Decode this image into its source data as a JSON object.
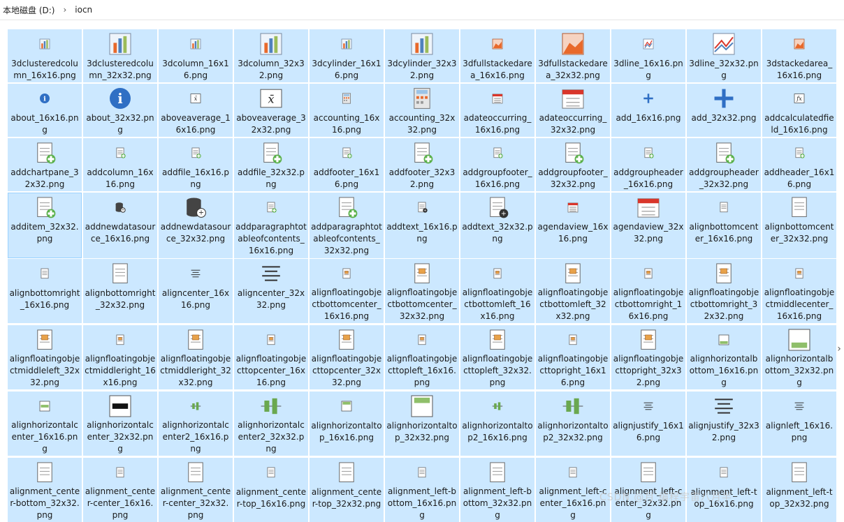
{
  "breadcrumb": {
    "drive": "本地磁盘 (D:)",
    "separator": "›",
    "folder": "iocn"
  },
  "watermark": "CSDN @月    编程宇宙八月半",
  "rows": [
    [
      {
        "name": "3dclusteredcolumn_16x16.png",
        "icon": "clustered-column-small"
      },
      {
        "name": "3dclusteredcolumn_32x32.png",
        "icon": "clustered-column-large"
      },
      {
        "name": "3dcolumn_16x16.png",
        "icon": "column-small"
      },
      {
        "name": "3dcolumn_32x32.png",
        "icon": "column-large"
      },
      {
        "name": "3dcylinder_16x16.png",
        "icon": "cylinder-small"
      },
      {
        "name": "3dcylinder_32x32.png",
        "icon": "cylinder-large"
      },
      {
        "name": "3dfullstackedarea_16x16.png",
        "icon": "stacked-area-small"
      },
      {
        "name": "3dfullstackedarea_32x32.png",
        "icon": "stacked-area-large"
      },
      {
        "name": "3dline_16x16.png",
        "icon": "line-chart-small"
      },
      {
        "name": "3dline_32x32.png",
        "icon": "line-chart-large"
      },
      {
        "name": "3dstackedarea_16x16.png",
        "icon": "stacked-area-small"
      }
    ],
    [
      {
        "name": "about_16x16.png",
        "icon": "info-small"
      },
      {
        "name": "about_32x32.png",
        "icon": "info-large"
      },
      {
        "name": "aboveaverage_16x16.png",
        "icon": "above-average-small"
      },
      {
        "name": "aboveaverage_32x32.png",
        "icon": "above-average-large"
      },
      {
        "name": "accounting_16x16.png",
        "icon": "accounting-small"
      },
      {
        "name": "accounting_32x32.png",
        "icon": "calculator-large"
      },
      {
        "name": "adateoccurring_16x16.png",
        "icon": "calendar-small"
      },
      {
        "name": "adateoccurring_32x32.png",
        "icon": "calendar-large"
      },
      {
        "name": "add_16x16.png",
        "icon": "plus-small"
      },
      {
        "name": "add_32x32.png",
        "icon": "plus-large"
      },
      {
        "name": "addcalculatedfield_16x16.png",
        "icon": "function-small"
      }
    ],
    [
      {
        "name": "addchartpane_32x32.png",
        "icon": "chartpane-large"
      },
      {
        "name": "addcolumn_16x16.png",
        "icon": "addcolumn-small"
      },
      {
        "name": "addfile_16x16.png",
        "icon": "addfile-small"
      },
      {
        "name": "addfile_32x32.png",
        "icon": "addfile-large"
      },
      {
        "name": "addfooter_16x16.png",
        "icon": "footer-small"
      },
      {
        "name": "addfooter_32x32.png",
        "icon": "footer-large"
      },
      {
        "name": "addgroupfooter_16x16.png",
        "icon": "group-small"
      },
      {
        "name": "addgroupfooter_32x32.png",
        "icon": "group-large"
      },
      {
        "name": "addgroupheader_16x16.png",
        "icon": "group-small"
      },
      {
        "name": "addgroupheader_32x32.png",
        "icon": "group-large"
      },
      {
        "name": "addheader_16x16.png",
        "icon": "group-small"
      }
    ],
    [
      {
        "name": "additem_32x32.png",
        "icon": "additem-large",
        "focused": true
      },
      {
        "name": "addnewdatasource_16x16.png",
        "icon": "datasource-small"
      },
      {
        "name": "addnewdatasource_32x32.png",
        "icon": "datasource-large"
      },
      {
        "name": "addparagraphtotableofcontents_16x16.png",
        "icon": "paragraph-small"
      },
      {
        "name": "addparagraphtotableofcontents_32x32.png",
        "icon": "paragraph-large"
      },
      {
        "name": "addtext_16x16.png",
        "icon": "addtext-small"
      },
      {
        "name": "addtext_32x32.png",
        "icon": "addtext-large"
      },
      {
        "name": "agendaview_16x16.png",
        "icon": "agenda-small"
      },
      {
        "name": "agendaview_32x32.png",
        "icon": "agenda-large"
      },
      {
        "name": "alignbottomcenter_16x16.png",
        "icon": "align-small"
      },
      {
        "name": "alignbottomcenter_32x32.png",
        "icon": "align-large"
      }
    ],
    [
      {
        "name": "alignbottomright_16x16.png",
        "icon": "align-small"
      },
      {
        "name": "alignbottomright_32x32.png",
        "icon": "align-large"
      },
      {
        "name": "aligncenter_16x16.png",
        "icon": "lines-small"
      },
      {
        "name": "aligncenter_32x32.png",
        "icon": "lines-large"
      },
      {
        "name": "alignfloatingobjectbottomcenter_16x16.png",
        "icon": "float-small"
      },
      {
        "name": "alignfloatingobjectbottomcenter_32x32.png",
        "icon": "float-large"
      },
      {
        "name": "alignfloatingobjectbottomleft_16x16.png",
        "icon": "float-small"
      },
      {
        "name": "alignfloatingobjectbottomleft_32x32.png",
        "icon": "float-large"
      },
      {
        "name": "alignfloatingobjectbottomright_16x16.png",
        "icon": "float-small"
      },
      {
        "name": "alignfloatingobjectbottomright_32x32.png",
        "icon": "float-large"
      },
      {
        "name": "alignfloatingobjectmiddlecenter_16x16.png",
        "icon": "float-small"
      }
    ],
    [
      {
        "name": "alignfloatingobjectmiddleleft_32x32.png",
        "icon": "float-large"
      },
      {
        "name": "alignfloatingobjectmiddleright_16x16.png",
        "icon": "float-small"
      },
      {
        "name": "alignfloatingobjectmiddleright_32x32.png",
        "icon": "float-large"
      },
      {
        "name": "alignfloatingobjecttopcenter_16x16.png",
        "icon": "float-small"
      },
      {
        "name": "alignfloatingobjecttopcenter_32x32.png",
        "icon": "float-large"
      },
      {
        "name": "alignfloatingobjecttopleft_16x16.png",
        "icon": "float-small"
      },
      {
        "name": "alignfloatingobjecttopleft_32x32.png",
        "icon": "float-large"
      },
      {
        "name": "alignfloatingobjecttopright_16x16.png",
        "icon": "float-small"
      },
      {
        "name": "alignfloatingobjecttopright_32x32.png",
        "icon": "float-large"
      },
      {
        "name": "alignhorizontalbottom_16x16.png",
        "icon": "hbottom-small"
      },
      {
        "name": "alignhorizontalbottom_32x32.png",
        "icon": "hbottom-large"
      }
    ],
    [
      {
        "name": "alignhorizontalcenter_16x16.png",
        "icon": "hcenter-small"
      },
      {
        "name": "alignhorizontalcenter_32x32.png",
        "icon": "hcenter-large"
      },
      {
        "name": "alignhorizontalcenter2_16x16.png",
        "icon": "hcenter2-small"
      },
      {
        "name": "alignhorizontalcenter2_32x32.png",
        "icon": "hcenter2-large"
      },
      {
        "name": "alignhorizontaltop_16x16.png",
        "icon": "htop-small"
      },
      {
        "name": "alignhorizontaltop_32x32.png",
        "icon": "htop-large"
      },
      {
        "name": "alignhorizontaltop2_16x16.png",
        "icon": "htop2-small"
      },
      {
        "name": "alignhorizontaltop2_32x32.png",
        "icon": "htop2-large"
      },
      {
        "name": "alignjustify_16x16.png",
        "icon": "lines-small"
      },
      {
        "name": "alignjustify_32x32.png",
        "icon": "lines-large"
      },
      {
        "name": "alignleft_16x16.png",
        "icon": "lines-small"
      }
    ],
    [
      {
        "name": "alignment_center-bottom_32x32.png",
        "icon": "page-large"
      },
      {
        "name": "alignment_center-center_16x16.png",
        "icon": "page-small"
      },
      {
        "name": "alignment_center-center_32x32.png",
        "icon": "page-large"
      },
      {
        "name": "alignment_center-top_16x16.png",
        "icon": "page-small"
      },
      {
        "name": "alignment_center-top_32x32.png",
        "icon": "page-large"
      },
      {
        "name": "alignment_left-bottom_16x16.png",
        "icon": "page-small"
      },
      {
        "name": "alignment_left-bottom_32x32.png",
        "icon": "page-large"
      },
      {
        "name": "alignment_left-center_16x16.png",
        "icon": "page-small"
      },
      {
        "name": "alignment_left-center_32x32.png",
        "icon": "page-large"
      },
      {
        "name": "alignment_left-top_16x16.png",
        "icon": "page-small"
      },
      {
        "name": "alignment_left-top_32x32.png",
        "icon": "page-large"
      }
    ]
  ]
}
